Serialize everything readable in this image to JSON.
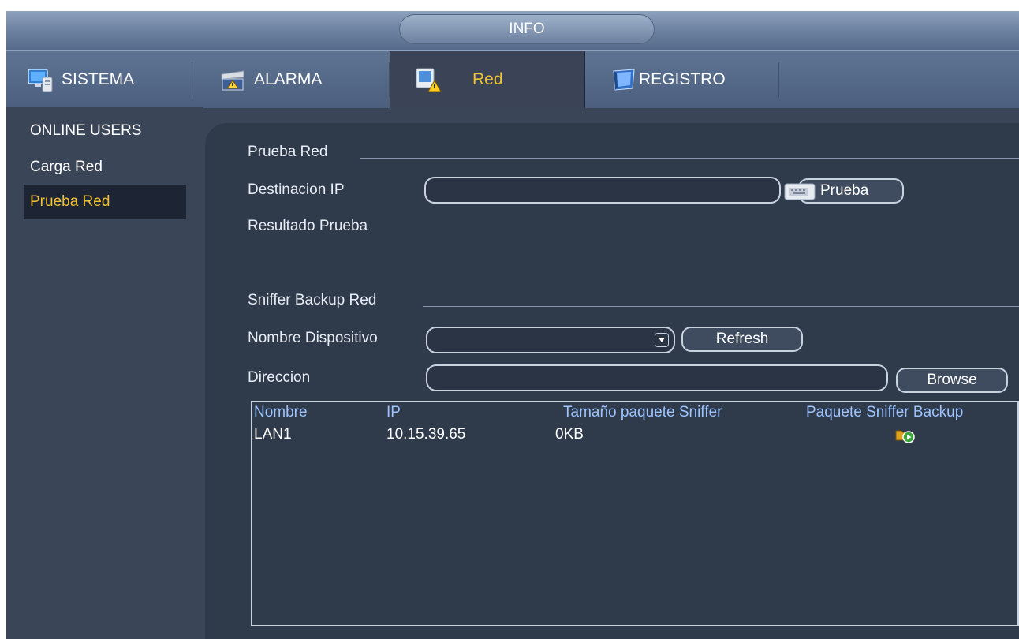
{
  "window": {
    "title": "INFO"
  },
  "tabs": [
    {
      "label": "SISTEMA",
      "icon": "monitor-icon",
      "active": false
    },
    {
      "label": "ALARMA",
      "icon": "alarm-icon",
      "active": false
    },
    {
      "label": "Red",
      "icon": "network-icon",
      "active": true
    },
    {
      "label": "REGISTRO",
      "icon": "book-icon",
      "active": false
    }
  ],
  "sidebar": {
    "items": [
      {
        "label": "ONLINE USERS",
        "active": false
      },
      {
        "label": "Carga Red",
        "active": false
      },
      {
        "label": "Prueba Red",
        "active": true
      }
    ]
  },
  "test_section": {
    "title": "Prueba Red",
    "dest_ip_label": "Destinacion IP",
    "dest_ip_value": "",
    "test_button": "Prueba",
    "result_label": "Resultado Prueba"
  },
  "sniffer_section": {
    "title": "Sniffer Backup Red",
    "device_label": "Nombre Dispositivo",
    "device_value": "",
    "refresh_button": "Refresh",
    "address_label": "Direccion",
    "address_value": "",
    "browse_button": "Browse"
  },
  "table": {
    "columns": [
      "Nombre",
      "IP",
      "Tamaño paquete Sniffer",
      "Paquete Sniffer Backup"
    ],
    "rows": [
      {
        "name": "LAN1",
        "ip": "10.15.39.65",
        "size": "0KB",
        "backup_icon": "backup-play-icon"
      }
    ]
  },
  "colors": {
    "accent": "#f2c232",
    "panel": "#2f3a4b",
    "background": "#3b4558"
  }
}
